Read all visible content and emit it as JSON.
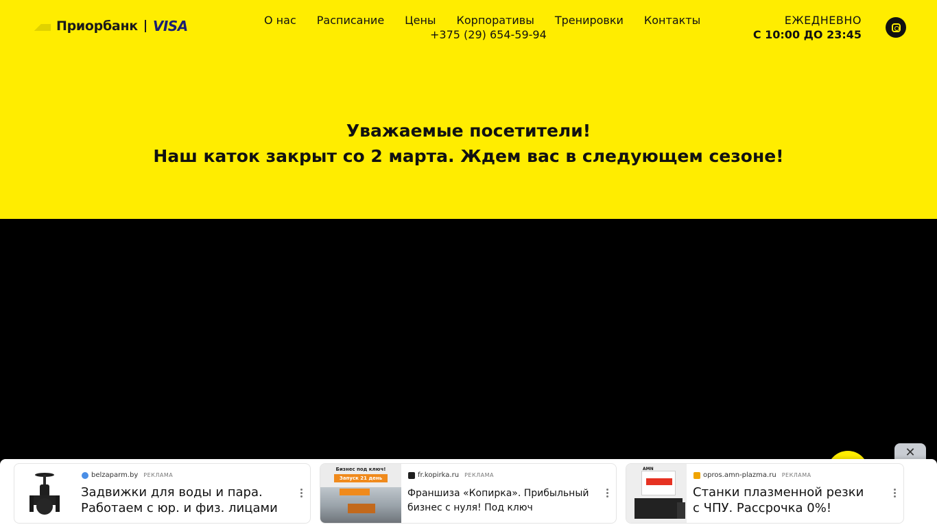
{
  "header": {
    "brand": "Приорбанк",
    "visa": "VISA",
    "nav": [
      "О нас",
      "Расписание",
      "Цены",
      "Корпоративы",
      "Тренировки",
      "Контакты"
    ],
    "phone": "+375 (29) 654-59-94",
    "hours_label": "ЕЖЕДНЕВНО",
    "hours_value": "С 10:00 ДО 23:45",
    "social_icon": "instagram-icon"
  },
  "notice": {
    "line1": "Уважаемые посетители!",
    "line2": "Наш каток закрыт со 2 марта. Ждем вас в следующем сезоне!"
  },
  "ads": {
    "close": "✕",
    "label": "РЕКЛАМА",
    "items": [
      {
        "domain": "belzaparm.by",
        "title_line1": "Задвижки для воды и пара.",
        "title_line2": "Работаем с юр. и физ. лицами"
      },
      {
        "domain": "fr.kopirka.ru",
        "title_line1": "Франшиза «Копирка». Прибыльный",
        "title_line2": "бизнес с нуля! Под ключ",
        "img_line1": "Бизнес под ключ!",
        "img_line2": "Запуск 21 день"
      },
      {
        "domain": "opros.amn-plazma.ru",
        "title_line1": "Станки плазменной резки",
        "title_line2": "с ЧПУ. Рассрочка 0%!",
        "img_logo": "AMN"
      }
    ]
  },
  "colors": {
    "brand_yellow": "#ffed00",
    "text_dark": "#111111",
    "visa_blue": "#1a1f71"
  }
}
